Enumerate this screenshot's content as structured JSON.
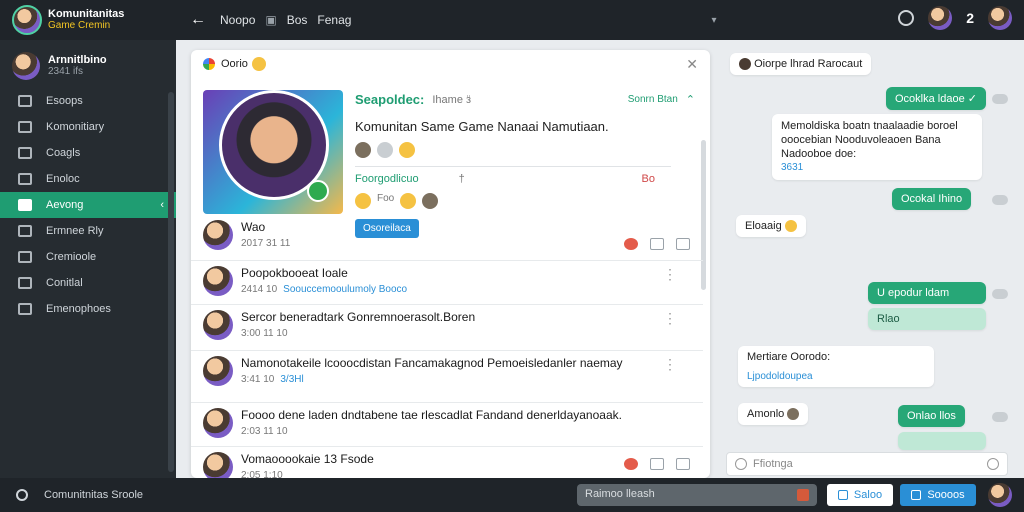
{
  "topbar": {
    "brand_title": "Komunitanitas",
    "brand_subtitle": "Game Cremin",
    "nav": [
      "Noopo",
      "Bos",
      "Fenag"
    ],
    "notif_count": "2",
    "icons": [
      "back-arrow-icon",
      "gamepad-icon",
      "clock-icon"
    ]
  },
  "sidebar": {
    "profile_name": "Arnnitlbino",
    "profile_sub": "2341 ifs",
    "items": [
      {
        "label": "Esoops",
        "icon": "chart-icon"
      },
      {
        "label": "Komonitiary",
        "icon": "home-icon"
      },
      {
        "label": "Coagls",
        "icon": "calendar-icon"
      },
      {
        "label": "Enoloc",
        "icon": "grid-icon"
      },
      {
        "label": "Aevong",
        "icon": "thumbs-up-icon",
        "active": true
      },
      {
        "label": "Ermnee Rly",
        "icon": "refresh-icon"
      },
      {
        "label": "Cremioole",
        "icon": "settings-icon"
      },
      {
        "label": "Conitlal",
        "icon": "folder-icon"
      },
      {
        "label": "Emenophoes",
        "icon": "phone-icon"
      }
    ]
  },
  "card": {
    "header_title": "Oorio",
    "hero": {
      "green_title": "Seapoldec:",
      "sub": "Ihame ӟ",
      "right_link": "Sonrn Btan",
      "headline": "Komunitan Same Game Nanaai Namutiaan.",
      "section_label": "Foorgodlicuo",
      "section_sub": "Foo",
      "tag": "Bo",
      "button": "Osoreilaca"
    },
    "posts": [
      {
        "title": "Wao",
        "meta": "2017 31 11",
        "blue": ""
      },
      {
        "title": "Poopokbooeat Ioale",
        "meta": "2414 10",
        "blue": "Soouccemooulumoly Booco"
      },
      {
        "title": "Sercor beneradtark Gonremnoerasolt.Boren",
        "meta": "3:00 11 10",
        "blue": ""
      },
      {
        "title": "Namonotakeile lcooocdistan Fancamakagnod Pemoeisledanler naemay",
        "meta": "3:41 10",
        "blue": "3/3Hl"
      },
      {
        "title": "Foooo dene laden dndtabene tae rlescadlat Fandand denerldayanoaak.",
        "meta": "2:03 11 10",
        "blue": ""
      },
      {
        "title": "Vomaooookaie 13 Fsode",
        "meta": "2:05 1:10",
        "blue": ""
      }
    ]
  },
  "chat": {
    "messages": [
      {
        "text": "Oiorpe lhrad Rarocaut",
        "style": "white"
      },
      {
        "text": "Ocoklka ldaoe",
        "style": "green"
      },
      {
        "text": "Memoldiska boatn tnaalaadie boroel ooocebian Nooduvoleaoen Bana Nadooboe doe:",
        "style": "white",
        "meta": "3631"
      },
      {
        "text": "Ocokal Ihino",
        "style": "green"
      },
      {
        "text": "Eloaaig",
        "style": "white"
      },
      {
        "text": "U epodur ldam",
        "style": "green"
      },
      {
        "text": "Rlao",
        "style": "lgreen"
      },
      {
        "text": "Mertiare Oorodo:",
        "style": "white",
        "sub": "Ljpodoldoupea"
      },
      {
        "text": "Amonlo",
        "style": "white"
      },
      {
        "text": "Onlao llos",
        "style": "green"
      },
      {
        "text": "",
        "style": "lgreen"
      }
    ],
    "input_placeholder": "Ffiotnga"
  },
  "bottombar": {
    "search_text": "Comunitnitas Sroole",
    "input_text": "Raimoo lleash",
    "btn_white": "Saloo",
    "btn_blue": "Soooos"
  },
  "colors": {
    "accent": "#1f9d72",
    "blue": "#2a8fd6",
    "dark": "#1f2429"
  }
}
